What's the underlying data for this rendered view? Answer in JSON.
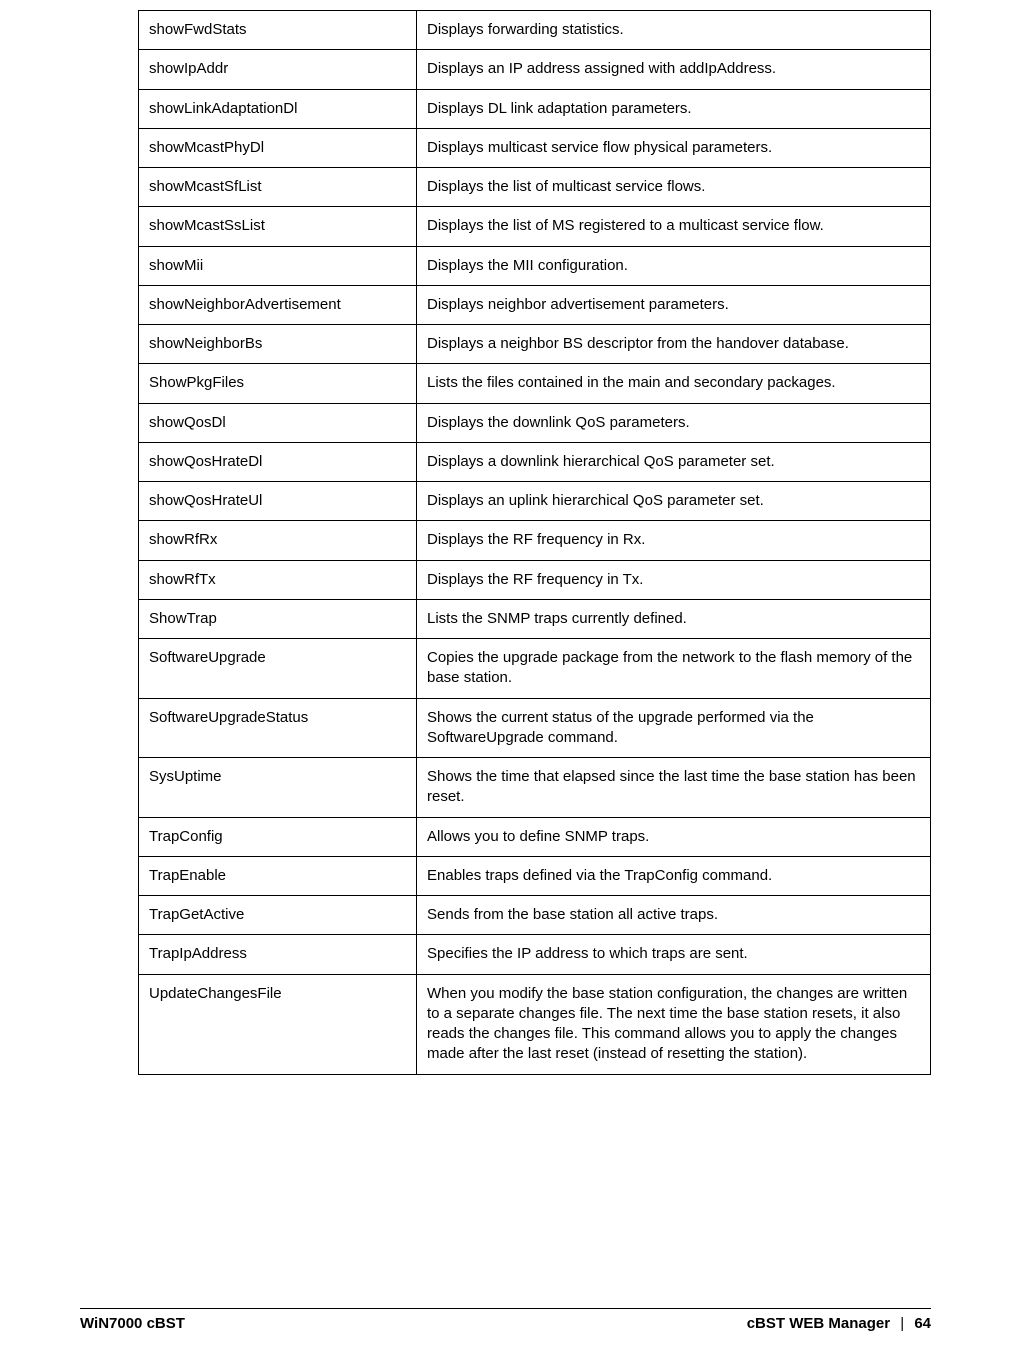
{
  "footer": {
    "left": "WiN7000 cBST",
    "right_title": "cBST WEB Manager",
    "separator": "|",
    "page_number": "64"
  },
  "rows": [
    {
      "cmd": "showFwdStats",
      "desc": "Displays forwarding statistics."
    },
    {
      "cmd": "showIpAddr",
      "desc": "Displays an IP address assigned with addIpAddress."
    },
    {
      "cmd": "showLinkAdaptationDl",
      "desc": "Displays DL link adaptation parameters."
    },
    {
      "cmd": "showMcastPhyDl",
      "desc": "Displays multicast service flow physical parameters."
    },
    {
      "cmd": "showMcastSfList",
      "desc": "Displays the list of multicast service flows."
    },
    {
      "cmd": "showMcastSsList",
      "desc": "Displays the list of MS registered to a multicast service flow."
    },
    {
      "cmd": "showMii",
      "desc": "Displays the MII configuration."
    },
    {
      "cmd": "showNeighborAdvertisement",
      "desc": "Displays neighbor advertisement parameters."
    },
    {
      "cmd": "showNeighborBs",
      "desc": "Displays a neighbor BS descriptor from the handover database."
    },
    {
      "cmd": "ShowPkgFiles",
      "desc": "Lists the files contained in the main and secondary packages."
    },
    {
      "cmd": "showQosDl",
      "desc": "Displays the downlink QoS parameters."
    },
    {
      "cmd": "showQosHrateDl",
      "desc": "Displays a downlink hierarchical QoS parameter set."
    },
    {
      "cmd": "showQosHrateUl",
      "desc": "Displays an uplink hierarchical QoS parameter set."
    },
    {
      "cmd": "showRfRx",
      "desc": "Displays the RF frequency in Rx."
    },
    {
      "cmd": "showRfTx",
      "desc": "Displays the RF frequency in Tx."
    },
    {
      "cmd": "ShowTrap",
      "desc": "Lists the SNMP traps currently defined."
    },
    {
      "cmd": "SoftwareUpgrade",
      "desc": "Copies the upgrade package from the network to the flash memory of the base station."
    },
    {
      "cmd": "SoftwareUpgradeStatus",
      "desc": "Shows the current status of the upgrade performed via the SoftwareUpgrade command."
    },
    {
      "cmd": "SysUptime",
      "desc": "Shows the time that elapsed since the last time the base station has been reset."
    },
    {
      "cmd": "TrapConfig",
      "desc": "Allows you to define SNMP traps."
    },
    {
      "cmd": "TrapEnable",
      "desc": "Enables traps defined via the TrapConfig command."
    },
    {
      "cmd": "TrapGetActive",
      "desc": "Sends from the base station all active traps."
    },
    {
      "cmd": "TrapIpAddress",
      "desc": "Specifies the IP address to which traps are sent."
    },
    {
      "cmd": "UpdateChangesFile",
      "desc": "When you modify the base station configuration, the changes are written to a separate changes file. The next time the base station resets, it also reads the changes file. This command allows you to apply the changes made after the last reset (instead of resetting the station)."
    }
  ]
}
